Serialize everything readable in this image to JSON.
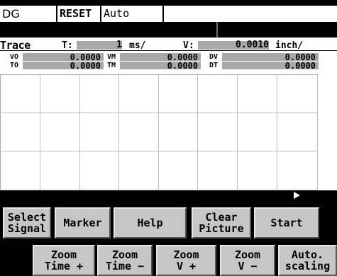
{
  "status": {
    "mode": "DG",
    "state": "RESET",
    "operation": "Auto",
    "message": ""
  },
  "trace": {
    "title": "Trace",
    "t_label": "T:",
    "t_value": "1",
    "t_unit": "ms/",
    "v_label": "V:",
    "v_value": "0.0010",
    "v_unit": "inch/",
    "row1": [
      {
        "label": "VO",
        "value": "0.0000"
      },
      {
        "label": "VM",
        "value": "0.0000"
      },
      {
        "label": "DV",
        "value": "0.0000"
      }
    ],
    "row2": [
      {
        "label": "TO",
        "value": "0.0000"
      },
      {
        "label": "TM",
        "value": "0.0000"
      },
      {
        "label": "DT",
        "value": "0.0000"
      }
    ]
  },
  "softkeys_row1": [
    {
      "label": "Select\nSignal"
    },
    {
      "label": "Marker"
    },
    {
      "label": "Help"
    },
    {
      "label": "Clear\nPicture"
    },
    {
      "label": "Start"
    }
  ],
  "softkeys_row2": [
    {
      "label": "Zoom\nTime +"
    },
    {
      "label": "Zoom\nTime −"
    },
    {
      "label": "Zoom\nV +"
    },
    {
      "label": "Zoom\nV −"
    },
    {
      "label": "Auto.\nscaling"
    }
  ]
}
